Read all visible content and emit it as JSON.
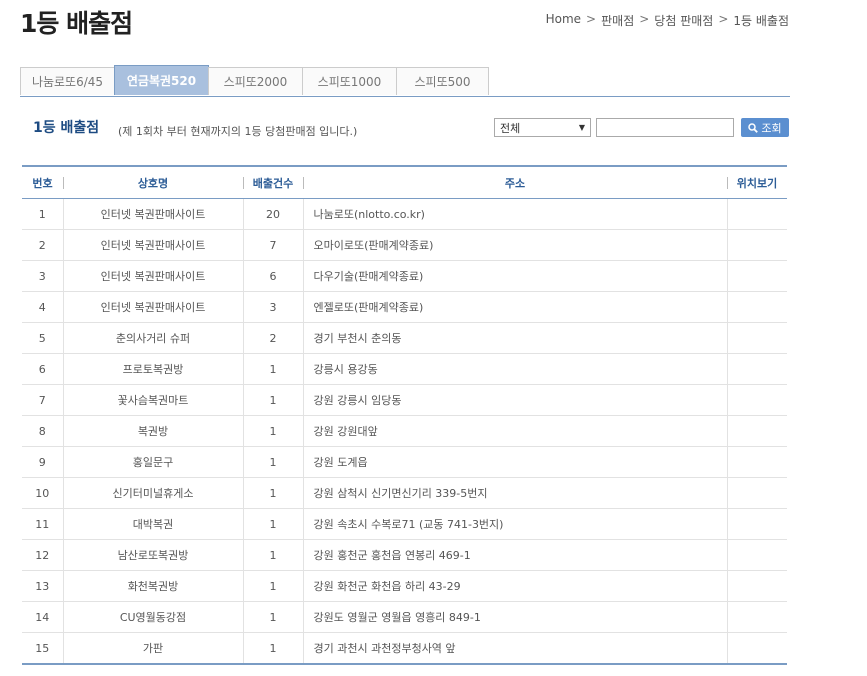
{
  "page": {
    "title": "1등 배출점"
  },
  "breadcrumb": [
    "Home",
    "판매점",
    "당첨 판매점",
    "1등 배출점"
  ],
  "tabs": [
    {
      "label": "나눔로또6/45",
      "active": false
    },
    {
      "label": "연금복권520",
      "active": true
    },
    {
      "label": "스피또2000",
      "active": false
    },
    {
      "label": "스피또1000",
      "active": false
    },
    {
      "label": "스피또500",
      "active": false
    }
  ],
  "section": {
    "title": "1등 배출점",
    "description": "(제 1회차 부터 현재까지의 1등 당첨판매점 입니다.)"
  },
  "search": {
    "region_selected": "전체",
    "input_value": "",
    "button_label": "조회"
  },
  "table": {
    "headers": [
      "번호",
      "상호명",
      "배출건수",
      "주소",
      "위치보기"
    ],
    "rows": [
      [
        "1",
        "인터넷 복권판매사이트",
        "20",
        "나눔로또(nlotto.co.kr)"
      ],
      [
        "2",
        "인터넷 복권판매사이트",
        "7",
        "오마이로또(판매계약종료)"
      ],
      [
        "3",
        "인터넷 복권판매사이트",
        "6",
        "다우기술(판매계약종료)"
      ],
      [
        "4",
        "인터넷 복권판매사이트",
        "3",
        "엔젤로또(판매계약종료)"
      ],
      [
        "5",
        "춘의사거리 슈퍼",
        "2",
        "경기 부천시 춘의동"
      ],
      [
        "6",
        "프로토복권방",
        "1",
        "강릉시 용강동"
      ],
      [
        "7",
        "꽃사슴복권마트",
        "1",
        "강원 강릉시 임당동"
      ],
      [
        "8",
        "복권방",
        "1",
        "강원 강원대앞"
      ],
      [
        "9",
        "홍일문구",
        "1",
        "강원 도계읍"
      ],
      [
        "10",
        "신기터미널휴게소",
        "1",
        "강원 삼척시 신기면신기리 339-5번지"
      ],
      [
        "11",
        "대박복권",
        "1",
        "강원 속초시 수복로71 (교동 741-3번지)"
      ],
      [
        "12",
        "남산로또복권방",
        "1",
        "강원 홍천군 홍천읍 연봉리 469-1"
      ],
      [
        "13",
        "화천복권방",
        "1",
        "강원 화천군 화천읍 하리 43-29"
      ],
      [
        "14",
        "CU영월동강점",
        "1",
        "강원도 영월군 영월읍 영흥리 849-1"
      ],
      [
        "15",
        "가판",
        "1",
        "경기 과천시 과천정부청사역 앞"
      ]
    ]
  },
  "icons": {
    "search_button_icon": "magnifier-icon",
    "select_arrow": "triangle-down-icon"
  },
  "colors": {
    "accent": "#5b8fd0",
    "header_text": "#2d5d97",
    "active_tab": "#a9c0de",
    "border": "#7a9cc4"
  }
}
